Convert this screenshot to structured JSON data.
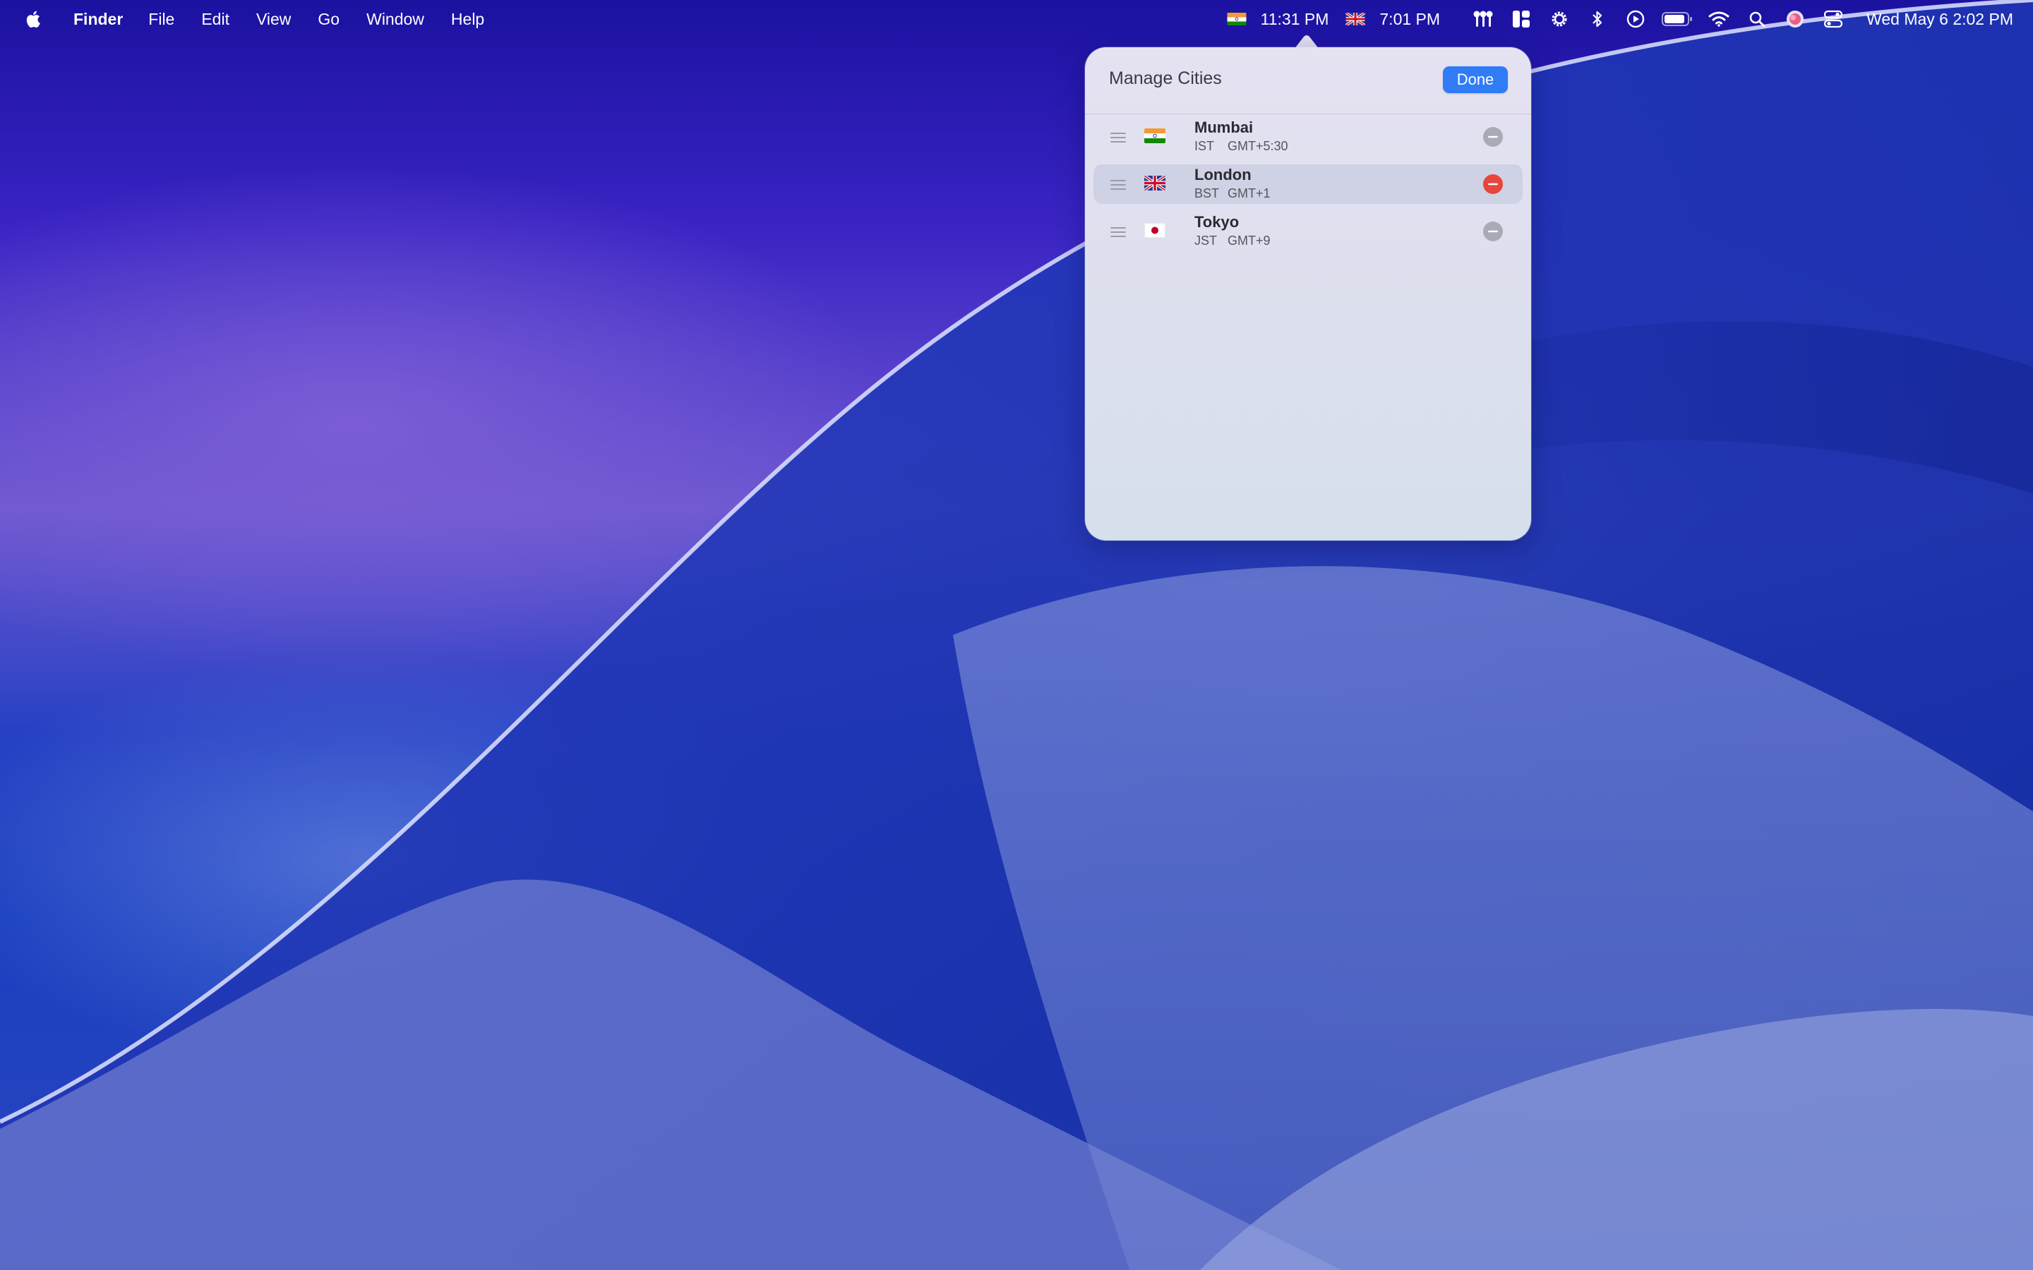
{
  "menubar": {
    "app_name": "Finder",
    "menus": [
      "File",
      "Edit",
      "View",
      "Go",
      "Window",
      "Help"
    ],
    "world_clocks": [
      {
        "flag": "india-flag-icon",
        "time": "11:31 PM"
      },
      {
        "flag": "uk-flag-icon",
        "time": "7:01 PM"
      }
    ],
    "status_icons": [
      "airpods-icon",
      "stage-manager-icon",
      "gear-icon",
      "bluetooth-icon",
      "play-circle-icon",
      "battery-icon",
      "wifi-icon",
      "search-icon",
      "siri-icon",
      "control-center-icon"
    ],
    "clock": "Wed May 6  2:02 PM"
  },
  "popover": {
    "title": "Manage Cities",
    "done_label": "Done",
    "cities": [
      {
        "name": "Mumbai",
        "zone": "IST",
        "offset": "GMT+5:30",
        "flag": "india-flag-icon",
        "highlighted": false
      },
      {
        "name": "London",
        "zone": "BST",
        "offset": "GMT+1",
        "flag": "uk-flag-icon",
        "highlighted": true
      },
      {
        "name": "Tokyo",
        "zone": "JST",
        "offset": "GMT+9",
        "flag": "japan-flag-icon",
        "highlighted": false
      }
    ]
  },
  "colors": {
    "accent": "#2f7cf6",
    "remove_active": "#e8453c",
    "remove_inactive": "#a8abb6"
  }
}
